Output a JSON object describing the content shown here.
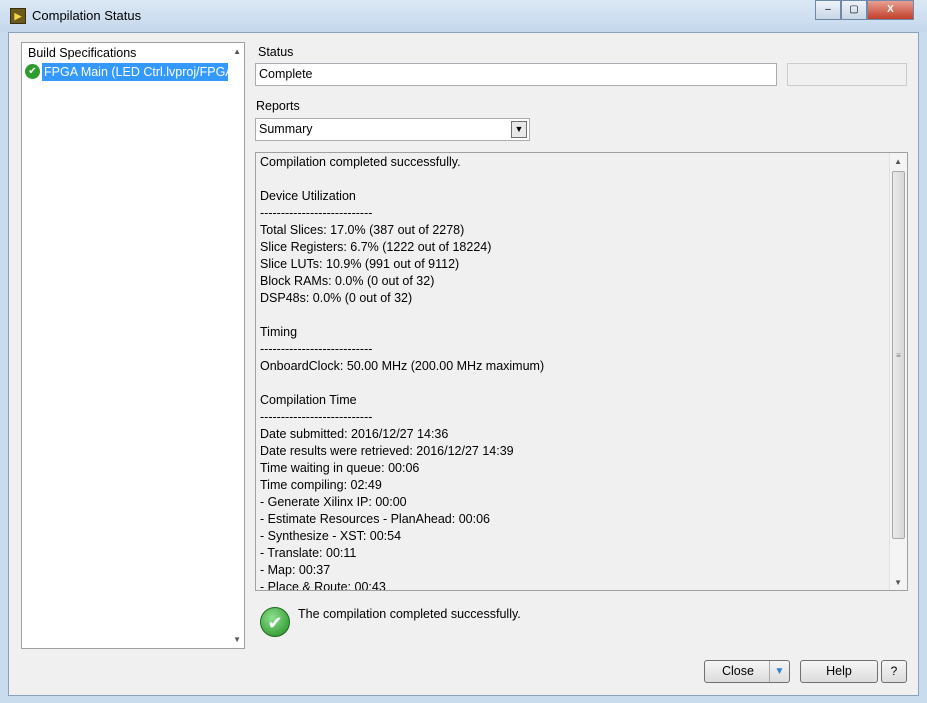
{
  "window": {
    "title": "Compilation Status",
    "icon": "labview-icon",
    "controls": {
      "minimize": "‒",
      "maximize": "▢",
      "close": "X"
    }
  },
  "tree": {
    "header": "Build Specifications",
    "items": [
      {
        "label": "FPGA Main (LED Ctrl.lvproj/FPGA",
        "status": "success"
      }
    ]
  },
  "status": {
    "label": "Status",
    "value": "Complete",
    "extra_value": ""
  },
  "reports": {
    "label": "Reports",
    "selected": "Summary"
  },
  "report_lines": [
    "Compilation completed successfully.",
    "",
    "Device Utilization",
    "---------------------------",
    "Total Slices: 17.0% (387 out of 2278)",
    "Slice Registers: 6.7% (1222 out of 18224)",
    "Slice LUTs: 10.9% (991 out of 9112)",
    "Block RAMs: 0.0% (0 out of 32)",
    "DSP48s: 0.0% (0 out of 32)",
    "",
    "Timing",
    "---------------------------",
    "OnboardClock: 50.00 MHz (200.00 MHz maximum)",
    "",
    "Compilation Time",
    "---------------------------",
    "Date submitted: 2016/12/27 14:36",
    "Date results were retrieved: 2016/12/27 14:39",
    "Time waiting in queue: 00:06",
    "Time compiling: 02:49",
    "- Generate Xilinx IP: 00:00",
    "- Estimate Resources - PlanAhead: 00:06",
    "- Synthesize - XST: 00:54",
    "- Translate: 00:11",
    "- Map: 00:37",
    "- Place & Route: 00:43"
  ],
  "message": "The compilation completed successfully.",
  "buttons": {
    "close": "Close",
    "help": "Help"
  }
}
